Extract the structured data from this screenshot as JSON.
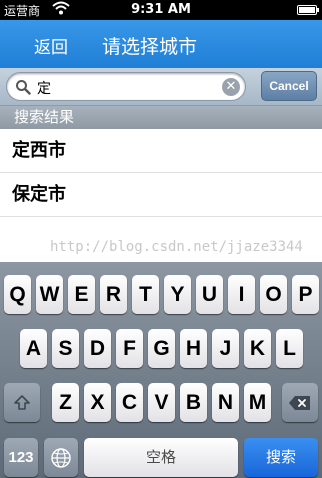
{
  "status": {
    "carrier": "运营商",
    "time": "9:31 AM"
  },
  "nav": {
    "back_label": "返回",
    "title": "请选择城市"
  },
  "search": {
    "query": "定",
    "cancel_label": "Cancel"
  },
  "results_header": "搜索结果",
  "results": [
    "定西市",
    "保定市"
  ],
  "watermark": "http://blog.csdn.net/jjaze3344",
  "keyboard": {
    "row1": [
      "Q",
      "W",
      "E",
      "R",
      "T",
      "Y",
      "U",
      "I",
      "O",
      "P"
    ],
    "row2": [
      "A",
      "S",
      "D",
      "F",
      "G",
      "H",
      "J",
      "K",
      "L"
    ],
    "row3": [
      "Z",
      "X",
      "C",
      "V",
      "B",
      "N",
      "M"
    ],
    "numbers_label": "123",
    "space_label": "空格",
    "search_label": "搜索",
    "icons": {
      "shift": "shift-icon",
      "delete": "delete-icon",
      "globe": "globe-icon"
    }
  }
}
